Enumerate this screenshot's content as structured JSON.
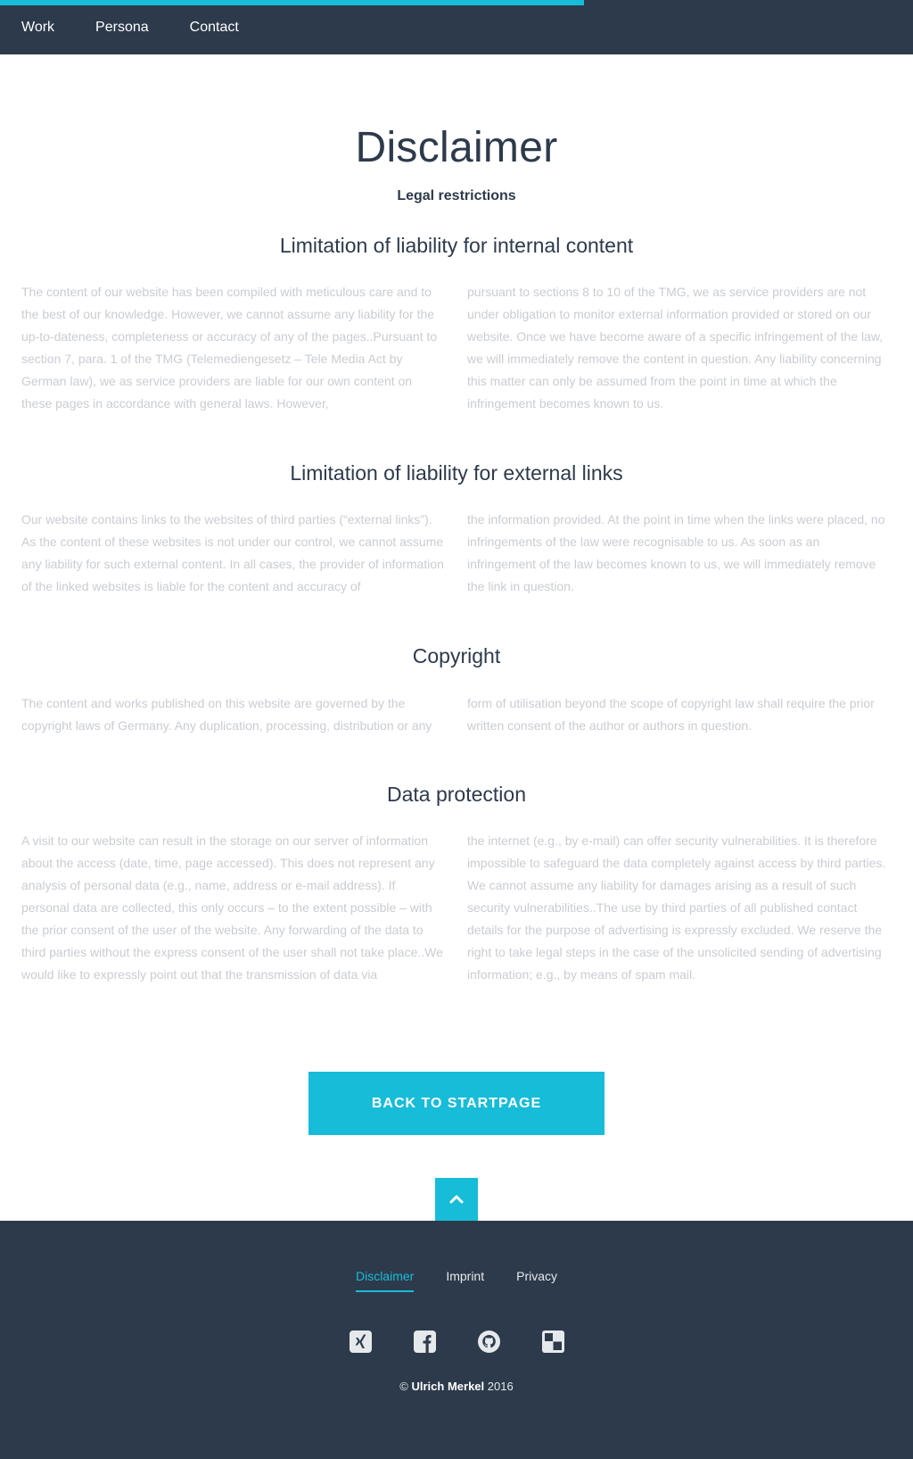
{
  "header": {
    "nav": [
      "Work",
      "Persona",
      "Contact"
    ],
    "scroll_progress_percent": 64
  },
  "page": {
    "title": "Disclaimer",
    "subtitle": "Legal restrictions"
  },
  "sections": [
    {
      "heading": "Limitation of liability for internal content",
      "col1": "The content of our website has been compiled with meticulous care and to the best of our knowledge. However, we cannot assume any liability for the up-to-dateness, completeness or accuracy of any of the pages..Pursuant to section 7, para. 1 of the TMG (Telemediengesetz – Tele Media Act by German law), we as service providers are liable for our own content on these pages in accordance with general laws. However,",
      "col2": "pursuant to sections 8 to 10 of the TMG, we as service providers are not under obligation to monitor external information provided or stored on our website. Once we have become aware of a specific infringement of the law, we will immediately remove the content in question. Any liability concerning this matter can only be assumed from the point in time at which the infringement becomes known to us."
    },
    {
      "heading": "Limitation of liability for external links",
      "col1": "Our website contains links to the websites of third parties (“external links”). As the content of these websites is not under our control, we cannot assume any liability for such external content. In all cases, the provider of information of the linked websites is liable for the content and accuracy of",
      "col2": "the information provided. At the point in time when the links were placed, no infringements of the law were recognisable to us. As soon as an infringement of the law becomes known to us, we will immediately remove the link in question."
    },
    {
      "heading": "Copyright",
      "col1": "The content and works published on this website are governed by the copyright laws of Germany. Any duplication, processing, distribution or any",
      "col2": "form of utilisation beyond the scope of copyright law shall require the prior written consent of the author or authors in question."
    },
    {
      "heading": "Data protection",
      "col1": "A visit to our website can result in the storage on our server of information about the access (date, time, page accessed). This does not represent any analysis of personal data (e.g., name, address or e-mail address). If personal data are collected, this only occurs – to the extent possible – with the prior consent of the user of the website. Any forwarding of the data to third parties without the express consent of the user shall not take place..We would like to expressly point out that the transmission of data via",
      "col2": "the internet (e.g., by e-mail) can offer security vulnerabilities. It is therefore impossible to safeguard the data completely against access by third parties. We cannot assume any liability for damages arising as a result of such security vulnerabilities..The use by third parties of all published contact details for the purpose of advertising is expressly excluded. We reserve the right to take legal steps in the case of the unsolicited sending of advertising information; e.g., by means of spam mail."
    }
  ],
  "actions": {
    "back_label": "BACK TO STARTPAGE"
  },
  "footer": {
    "links": [
      "Disclaimer",
      "Imprint",
      "Privacy"
    ],
    "active_link": "Disclaimer",
    "social_icons": [
      "xing-icon",
      "facebook-icon",
      "github-icon",
      "delicious-icon"
    ],
    "copyright_symbol": "©",
    "copyright_name": "Ulrich Merkel",
    "copyright_year": "2016"
  },
  "colors": {
    "accent": "#17bcd8",
    "dark": "#2d3a4b",
    "body_text": "#c9cdd2"
  }
}
